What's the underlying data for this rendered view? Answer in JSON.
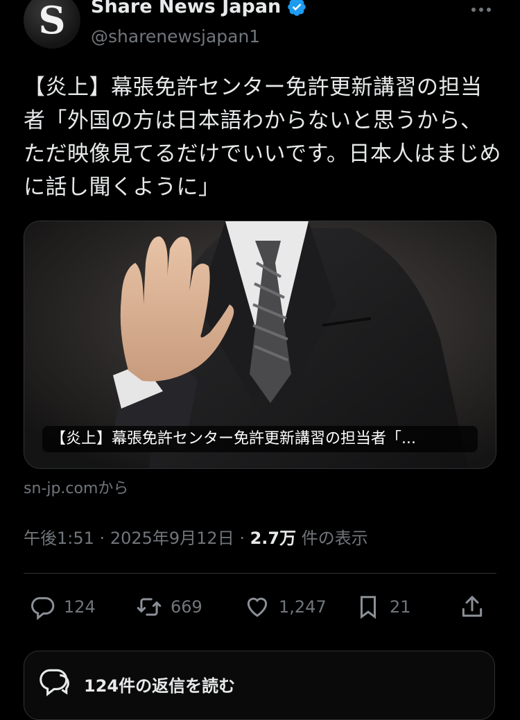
{
  "account": {
    "avatar_letter": "S",
    "name": "Share News Japan",
    "handle": "@sharenewsjapan1"
  },
  "tweet": {
    "text": "【炎上】幕張免許センター免許更新講習の担当者「外国の方は日本語わからないと思うから、ただ映像見てるだけでいいです。日本人はまじめに話し聞くように」"
  },
  "card": {
    "caption": "【炎上】幕張免許センター免許更新講習の担当者「...",
    "source": "sn-jp.comから"
  },
  "meta": {
    "time": "午後1:51",
    "date": "2025年9月12日",
    "views_count": "2.7万",
    "views_label": "件の表示"
  },
  "actions": {
    "replies": "124",
    "reposts": "669",
    "likes": "1,247",
    "bookmarks": "21"
  },
  "replies_button": {
    "label": "124件の返信を読む"
  },
  "colors": {
    "background": "#000000",
    "text": "#e7e9ea",
    "secondary": "#71767b",
    "verified": "#1d9bf0"
  }
}
